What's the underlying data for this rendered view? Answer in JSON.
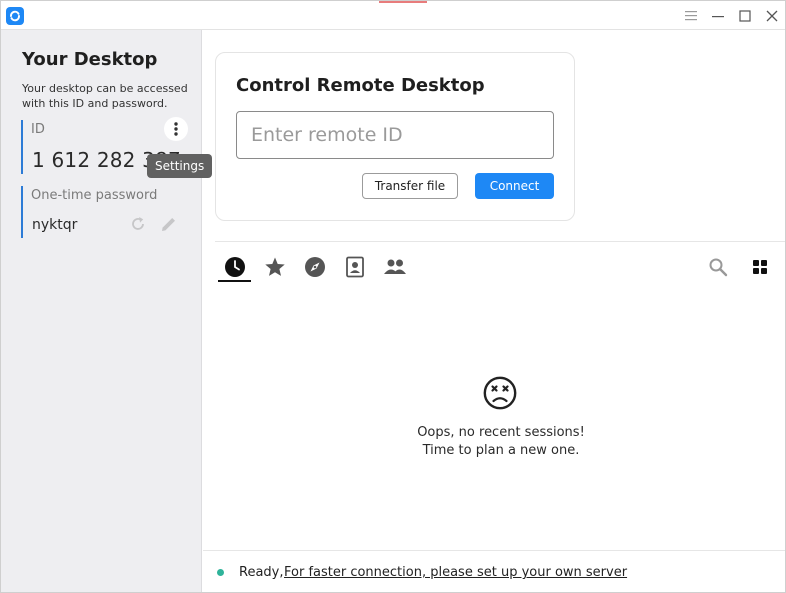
{
  "titlebar": {
    "icons": [
      "app-logo-icon",
      "hamburger-icon",
      "minimize-icon",
      "maximize-icon",
      "close-icon"
    ]
  },
  "left_panel": {
    "title": "Your Desktop",
    "description": "Your desktop can be accessed with this ID and password.",
    "id_label": "ID",
    "id_value": "1 612 282 387",
    "settings_tooltip": "Settings",
    "otp_label": "One-time password",
    "otp_value": "nyktqr"
  },
  "control": {
    "title": "Control Remote Desktop",
    "placeholder": "Enter remote ID",
    "transfer_label": "Transfer file",
    "connect_label": "Connect"
  },
  "tabs": [
    {
      "icon": "clock-icon",
      "selected": true
    },
    {
      "icon": "star-icon"
    },
    {
      "icon": "compass-icon"
    },
    {
      "icon": "address-book-icon"
    },
    {
      "icon": "group-icon"
    }
  ],
  "toolbar": {
    "icons": [
      "search-icon",
      "grid-view-icon"
    ]
  },
  "empty_state": {
    "icon": "sad-face-icon",
    "line1": "Oops, no recent sessions!",
    "line2": "Time to plan a new one."
  },
  "status": {
    "text": "Ready,",
    "link": "For faster connection, please set up your own server",
    "dot_color": "#2fb39a"
  },
  "colors": {
    "accent": "#1e88f5",
    "id_border": "#2c7bd6",
    "sidebar_bg": "#eeeef1"
  }
}
